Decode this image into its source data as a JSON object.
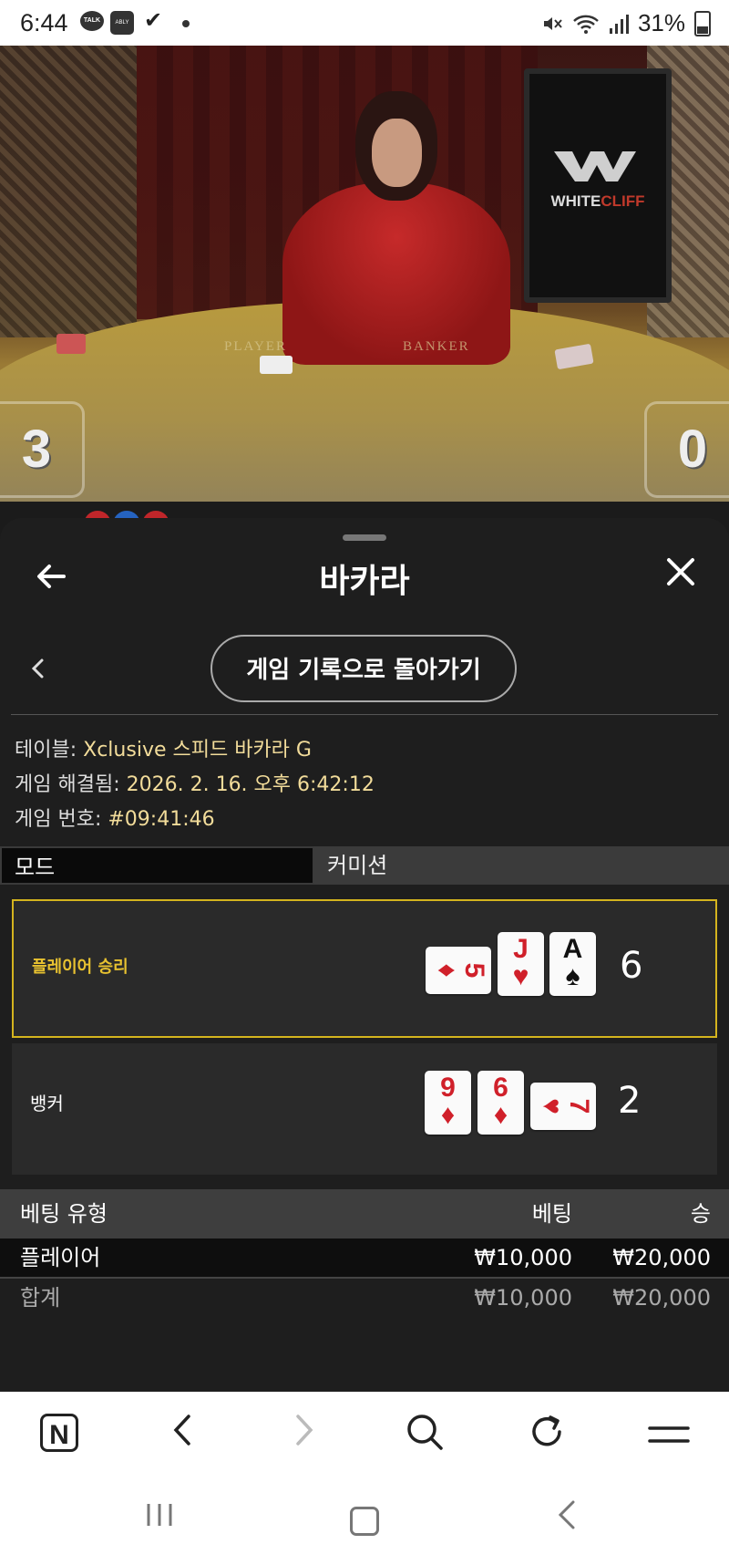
{
  "status_bar": {
    "time": "6:44",
    "talk_badge": "TALK",
    "ably_badge": "ABLY",
    "battery": "31%"
  },
  "video": {
    "table_labels": [
      "PLAYER",
      "BANKER"
    ],
    "monitor_brand_white": "WHITE",
    "monitor_brand_red": "CLIFF",
    "player_score": "3",
    "banker_score": "0"
  },
  "panel": {
    "title": "바카라",
    "return_button": "게임 기록으로 돌아가기",
    "info": {
      "table_label": "테이블: ",
      "table_value": "Xclusive 스피드 바카라 G",
      "resolved_label": "게임 해결됨: ",
      "resolved_value": "2026. 2. 16. 오후 6:42:12",
      "round_label": "게임 번호: ",
      "round_value": "#09:41:46"
    },
    "tabs": {
      "mode": "모드",
      "commission": "커미션"
    },
    "hands": {
      "player": {
        "label": "플레이어 승리",
        "total": "6",
        "cards": [
          {
            "rank": "5",
            "suit": "♦",
            "color": "red",
            "orientation": "horizontal"
          },
          {
            "rank": "J",
            "suit": "♥",
            "color": "red",
            "orientation": "vertical"
          },
          {
            "rank": "A",
            "suit": "♠",
            "color": "black",
            "orientation": "vertical"
          }
        ]
      },
      "banker": {
        "label": "뱅커",
        "total": "2",
        "cards": [
          {
            "rank": "9",
            "suit": "♦",
            "color": "red",
            "orientation": "vertical"
          },
          {
            "rank": "6",
            "suit": "♦",
            "color": "red",
            "orientation": "vertical"
          },
          {
            "rank": "7",
            "suit": "♥",
            "color": "red",
            "orientation": "horizontal"
          }
        ]
      }
    },
    "bets": {
      "headers": {
        "type": "베팅 유형",
        "bet": "베팅",
        "win": "승"
      },
      "rows": [
        {
          "type": "플레이어",
          "bet": "₩10,000",
          "win": "₩20,000"
        }
      ],
      "total": {
        "type": "합계",
        "bet": "₩10,000",
        "win": "₩20,000"
      }
    }
  },
  "browser_bar": {
    "home_badge": "N",
    "icons": [
      "n-home-icon",
      "back-icon",
      "forward-icon",
      "search-icon",
      "refresh-icon",
      "menu-icon"
    ]
  },
  "colors": {
    "highlight_gold": "#d4b41e",
    "info_value": "#f2dc9a",
    "panel_bg": "#1e1e1e"
  }
}
